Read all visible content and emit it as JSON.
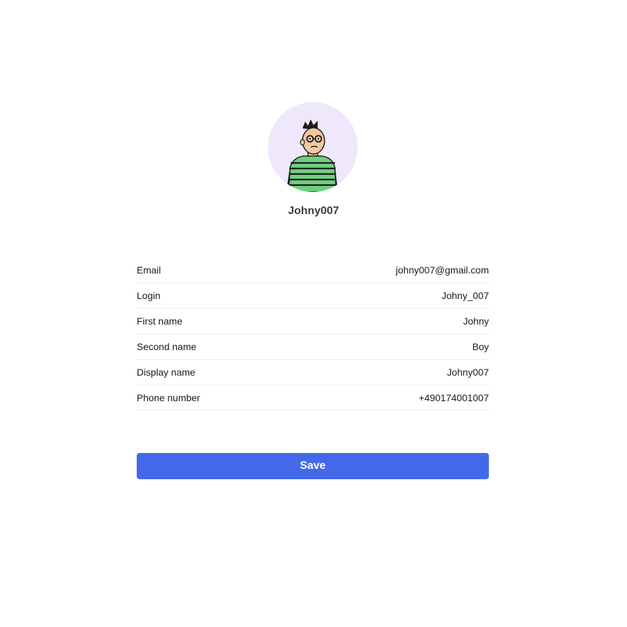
{
  "profile": {
    "display_name": "Johny007",
    "avatar_icon": "cartoon-person-avatar"
  },
  "fields": [
    {
      "label": "Email",
      "value": "johny007@gmail.com"
    },
    {
      "label": "Login",
      "value": "Johny_007"
    },
    {
      "label": "First name",
      "value": "Johny"
    },
    {
      "label": "Second name",
      "value": "Boy"
    },
    {
      "label": "Display name",
      "value": "Johny007"
    },
    {
      "label": "Phone number",
      "value": "+490174001007"
    }
  ],
  "actions": {
    "save_label": "Save"
  },
  "colors": {
    "accent": "#4469e8",
    "avatar_background": "#efe7fc",
    "divider": "#eaeaea"
  }
}
